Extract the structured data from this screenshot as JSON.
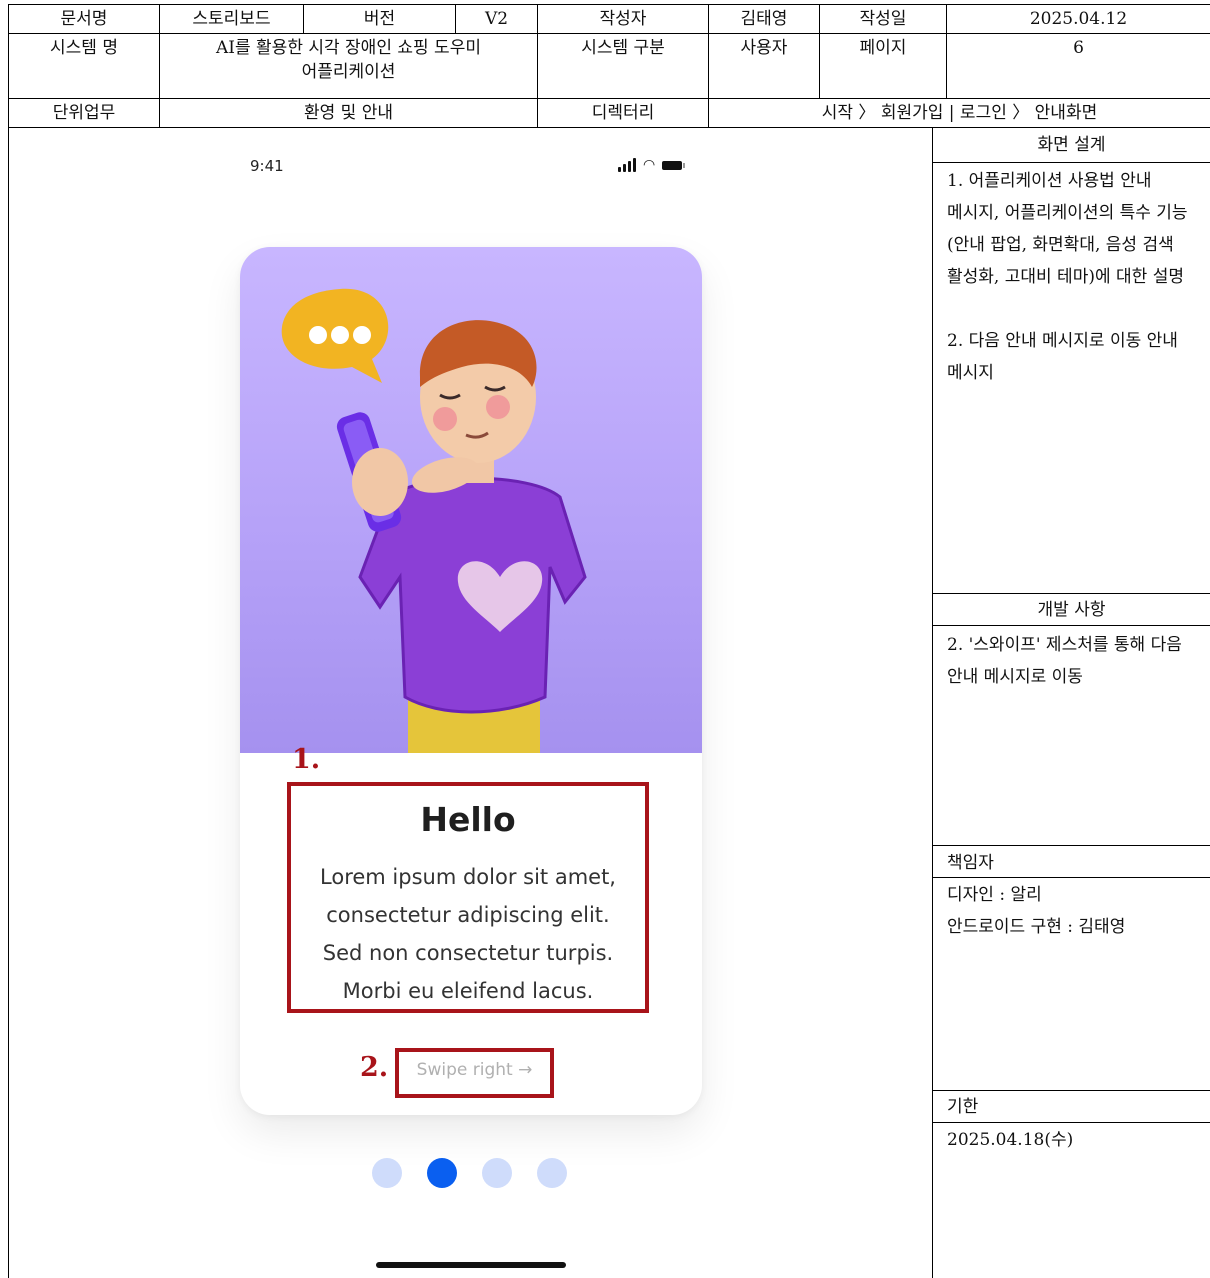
{
  "header": {
    "doc_name_label": "문서명",
    "doc_name_value": "스토리보드",
    "version_label": "버전",
    "version_value": "V2",
    "author_label": "작성자",
    "author_value": "김태영",
    "date_label": "작성일",
    "date_value": "2025.04.12",
    "system_name_label": "시스템 명",
    "system_name_value": "AI를 활용한 시각 장애인 쇼핑 도우미 어플리케이션",
    "system_type_label": "시스템 구분",
    "system_type_value": "사용자",
    "page_label": "페이지",
    "page_value": "6",
    "unit_task_label": "단위업무",
    "unit_task_value": "환영 및 안내",
    "directory_label": "디렉터리",
    "directory_value": "시작 〉 회원가입 | 로그인 〉 안내화면"
  },
  "phone": {
    "status_time": "9:41",
    "title": "Hello",
    "body_text": "Lorem ipsum dolor sit amet,\nconsectetur adipiscing elit.\nSed non consectetur turpis.\nMorbi eu eleifend lacus.",
    "swipe_label": "Swipe right →",
    "page_dots": {
      "count": 4,
      "active_index": 1
    },
    "illustration_icons": [
      "chat-bubble-icon",
      "character-with-phone-illustration",
      "heart-icon"
    ]
  },
  "annotations": {
    "one": "1.",
    "two": "2."
  },
  "panel": {
    "design_title": "화면 설계",
    "design_text": "1. 어플리케이션 사용법 안내 메시지, 어플리케이션의 특수 기능(안내 팝업, 화면확대, 음성 검색 활성화, 고대비 테마)에 대한 설명\n\n2. 다음 안내 메시지로 이동 안내 메시지",
    "dev_title": "개발 사항",
    "dev_text": "2. '스와이프' 제스처를 통해 다음 안내 메시지로 이동",
    "owner_title": "책임자",
    "owner_text": "디자인 : 알리\n안드로이드 구현 : 김태영",
    "deadline_title": "기한",
    "deadline_value": "2025.04.18(수)"
  },
  "colors": {
    "annotation_red": "#a8141a",
    "dot_active": "#0a5ff0",
    "dot_inactive": "#cfdcfb",
    "illustration_bg": "#b6a2f8"
  }
}
